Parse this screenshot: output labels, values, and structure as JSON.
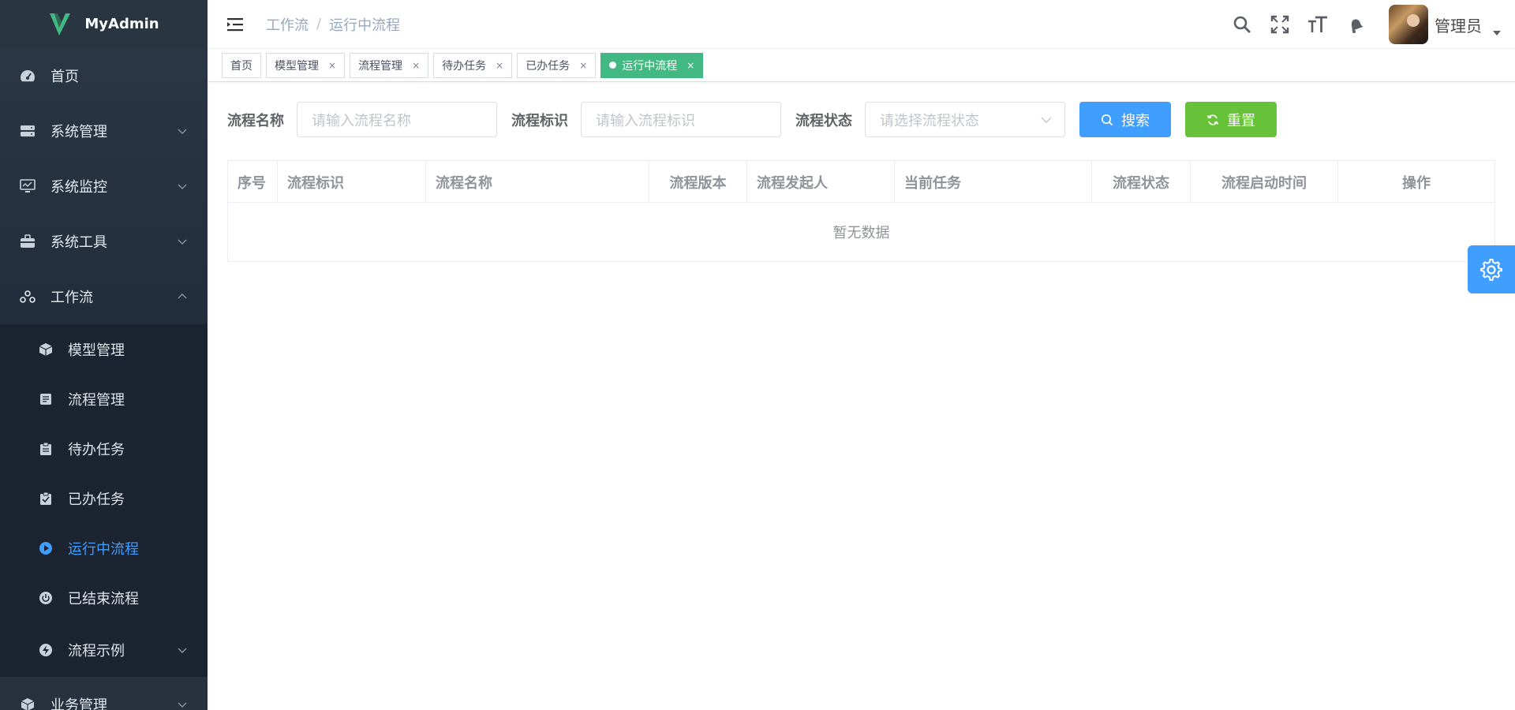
{
  "app": {
    "title": "MyAdmin",
    "accent": "#409eff",
    "tag_active_color": "#42b983"
  },
  "sidebar": {
    "items": [
      {
        "label": "首页",
        "icon": "dashboard-icon"
      },
      {
        "label": "系统管理",
        "icon": "server-icon"
      },
      {
        "label": "系统监控",
        "icon": "monitor-icon"
      },
      {
        "label": "系统工具",
        "icon": "toolbox-icon"
      },
      {
        "label": "工作流",
        "icon": "workflow-icon"
      }
    ],
    "workflow_sub": [
      {
        "label": "模型管理",
        "icon": "cube-icon"
      },
      {
        "label": "流程管理",
        "icon": "process-icon"
      },
      {
        "label": "待办任务",
        "icon": "clipboard-icon"
      },
      {
        "label": "已办任务",
        "icon": "clipboard-check-icon"
      },
      {
        "label": "运行中流程",
        "icon": "play-icon"
      },
      {
        "label": "已结束流程",
        "icon": "power-icon"
      },
      {
        "label": "流程示例",
        "icon": "bolt-icon"
      }
    ],
    "business": {
      "label": "业务管理",
      "icon": "cubes-icon"
    }
  },
  "navbar": {
    "breadcrumb": [
      "工作流",
      "运行中流程"
    ],
    "separator": "/",
    "user_name": "管理员"
  },
  "tags": [
    {
      "label": "首页",
      "closable": false
    },
    {
      "label": "模型管理",
      "closable": true
    },
    {
      "label": "流程管理",
      "closable": true
    },
    {
      "label": "待办任务",
      "closable": true
    },
    {
      "label": "已办任务",
      "closable": true
    },
    {
      "label": "运行中流程",
      "closable": true,
      "active": true
    }
  ],
  "tag_close": "×",
  "search": {
    "name_label": "流程名称",
    "name_placeholder": "请输入流程名称",
    "key_label": "流程标识",
    "key_placeholder": "请输入流程标识",
    "status_label": "流程状态",
    "status_placeholder": "请选择流程状态",
    "search_button": "搜索",
    "reset_button": "重置"
  },
  "table": {
    "columns": [
      "序号",
      "流程标识",
      "流程名称",
      "流程版本",
      "流程发起人",
      "当前任务",
      "流程状态",
      "流程启动时间",
      "操作"
    ],
    "empty_text": "暂无数据"
  }
}
